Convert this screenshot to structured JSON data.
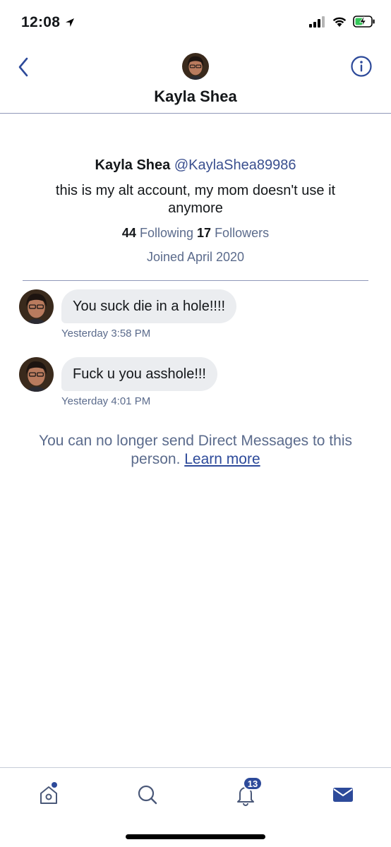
{
  "status_bar": {
    "time": "12:08",
    "icons": [
      "location-arrow-icon",
      "cellular-signal-icon",
      "wifi-icon",
      "battery-charging-icon"
    ]
  },
  "header": {
    "title": "Kayla Shea",
    "back_icon": "chevron-left-icon",
    "info_icon": "info-circle-icon"
  },
  "profile": {
    "name": "Kayla Shea",
    "handle": "@KaylaShea89986",
    "bio": "this is my alt account, my mom doesn't use it anymore",
    "following_count": "44",
    "following_label": "Following",
    "followers_count": "17",
    "followers_label": "Followers",
    "joined": "Joined April 2020"
  },
  "messages": [
    {
      "text": "You suck die in a hole!!!!",
      "time": "Yesterday 3:58 PM"
    },
    {
      "text": "Fuck u you asshole!!!",
      "time": "Yesterday 4:01 PM"
    }
  ],
  "notice": {
    "text": "You can no longer send Direct Messages to this person.",
    "link": "Learn more"
  },
  "tabbar": {
    "tabs": [
      {
        "name": "home",
        "icon": "home-icon",
        "has_dot": true
      },
      {
        "name": "search",
        "icon": "search-icon"
      },
      {
        "name": "notifications",
        "icon": "bell-icon",
        "badge": "13"
      },
      {
        "name": "messages",
        "icon": "envelope-icon",
        "active": true
      }
    ]
  },
  "colors": {
    "accent": "#2d4a9a",
    "bubble": "#ebedf0",
    "secondary_text": "#5b6b8c",
    "divider": "#8f98b8"
  }
}
